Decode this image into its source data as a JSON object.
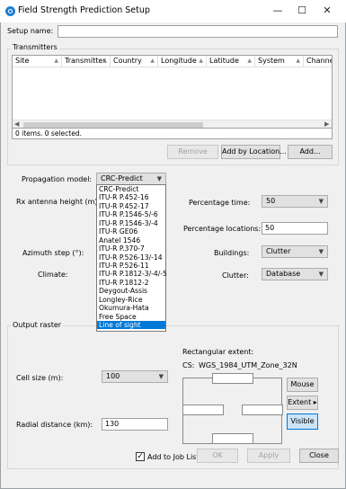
{
  "window": {
    "title": "Field Strength Prediction Setup",
    "minimize": "—",
    "maximize": "☐",
    "close": "✕"
  },
  "setup_name": {
    "label": "Setup name:",
    "value": ""
  },
  "transmitters": {
    "group_label": "Transmitters",
    "columns": [
      "Site",
      "Transmitter",
      "Country",
      "Longitude",
      "Latitude",
      "System",
      "Channel"
    ],
    "sort_glyph": "▲",
    "rows": [],
    "status": "0 items.  0 selected.",
    "remove_label": "Remove",
    "add_by_location_label": "Add by Location...",
    "add_label": "Add..."
  },
  "propagation": {
    "model_label": "Propagation model:",
    "model_value": "CRC-Predict",
    "options": [
      "CRC-Predict",
      "ITU-R P.452-16",
      "ITU-R P.452-17",
      "ITU-R P.1546-5/-6",
      "ITU-R P.1546-3/-4",
      "ITU-R GE06",
      "Anatel 1546",
      "ITU-R P.370-7",
      "ITU-R P.526-13/-14",
      "ITU-R P.526-11",
      "ITU-R P.1812-3/-4/-5",
      "ITU-R P.1812-2",
      "Deygout-Assis",
      "Longley-Rice",
      "Okumura-Hata",
      "Free Space",
      "Line of sight"
    ],
    "selected_option": "Line of sight",
    "rx_height_label": "Rx antenna height (m):",
    "azimuth_label": "Azimuth step (°):",
    "climate_label": "Climate:",
    "percentage_time_label": "Percentage time:",
    "percentage_time_value": "50",
    "percentage_locations_label": "Percentage locations:",
    "percentage_locations_value": "50",
    "buildings_label": "Buildings:",
    "buildings_value": "Clutter",
    "clutter_label": "Clutter:",
    "clutter_value": "Database"
  },
  "output": {
    "group_label": "Output raster",
    "cell_size_label": "Cell size (m):",
    "cell_size_value": "100",
    "radial_distance_label": "Radial distance (km):",
    "radial_distance_value": "130",
    "extent_label": "Rectangular extent:",
    "cs_label": "CS:",
    "cs_value": "WGS_1984_UTM_Zone_32N",
    "mouse_label": "Mouse",
    "extent_button_label": "Extent ▸",
    "visible_label": "Visible"
  },
  "footer": {
    "add_to_job_list_label": "Add to Job List",
    "add_to_job_list_checked": true,
    "check_glyph": "✓",
    "ok_label": "OK",
    "apply_label": "Apply",
    "close_label": "Close"
  },
  "icons": {
    "app": "globe-icon",
    "combo_arrow": "chevron-down-icon",
    "scroll_left": "chevron-left-icon",
    "scroll_right": "chevron-right-icon"
  },
  "colors": {
    "selection": "#0078d7",
    "visible_button": "#cce4f7",
    "app_icon": "#1e7fd0"
  }
}
